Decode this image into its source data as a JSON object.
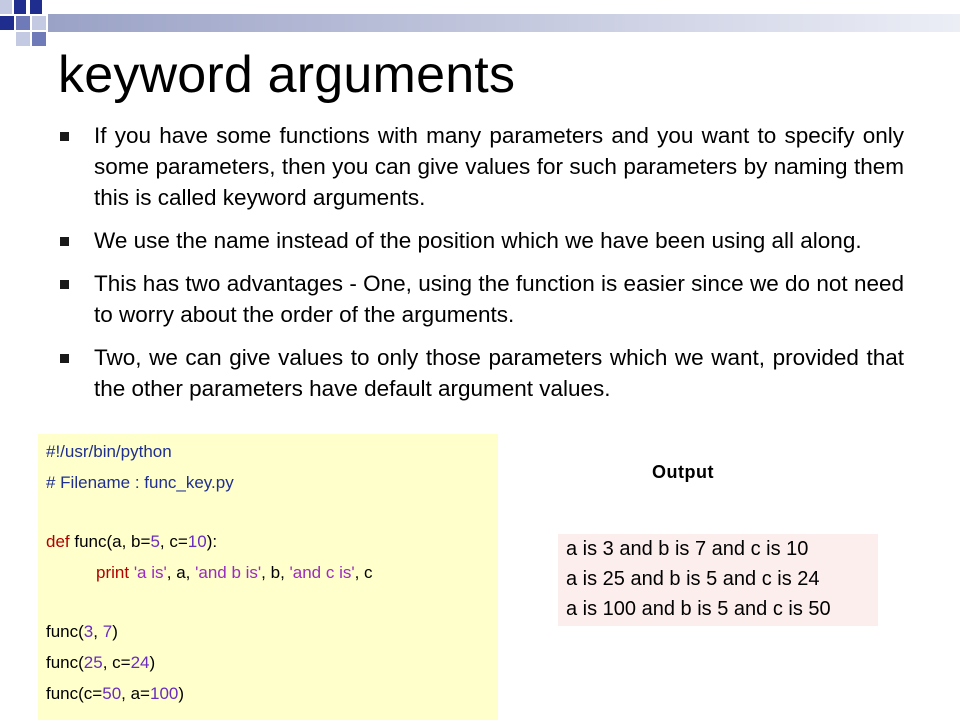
{
  "theme": {
    "square_dark": "#1f2d8f",
    "square_mid": "#6f7bb8",
    "square_light": "#c5cae3",
    "code_bg": "#ffffcc",
    "output_bg": "#fdeeee"
  },
  "slide": {
    "title": "keyword arguments",
    "bullets": [
      "If you have some functions with many parameters and you want to specify only some parameters, then you can give values for such parameters by naming them this is called keyword arguments.",
      "We use the name instead of the position which we have been using all along.",
      "This has two advantages - One, using the function is easier since we do not need to worry about the order of the arguments.",
      "Two, we can give values to only those parameters which we want, provided that the other parameters have default argument values."
    ]
  },
  "code": {
    "shebang": "#!/usr/bin/python",
    "filename_comment": "# Filename : func_key.py",
    "def_kw": "def",
    "def_name": " func(a, b=",
    "def_b": "5",
    "def_mid": ", c=",
    "def_c": "10",
    "def_end": "):",
    "print_kw": "print",
    "print_s1": "'a is'",
    "print_a": ", a, ",
    "print_s2": "'and b is'",
    "print_b": ", b, ",
    "print_s3": "'and c is'",
    "print_c": ", c",
    "call1_pre": "func(",
    "call1_a": "3",
    "call1_mid": ", ",
    "call1_b": "7",
    "call1_end": ")",
    "call2_pre": "func(",
    "call2_a": "25",
    "call2_mid": ", c=",
    "call2_c": "24",
    "call2_end": ")",
    "call3_pre": "func(c=",
    "call3_c": "50",
    "call3_mid": ", a=",
    "call3_a": "100",
    "call3_end": ")"
  },
  "output": {
    "label": "Output",
    "lines": [
      "a is 3 and b is 7 and c is 10",
      "a is 25 and b is 5 and c is 24",
      "a is 100 and b is 5 and c is 50"
    ]
  }
}
